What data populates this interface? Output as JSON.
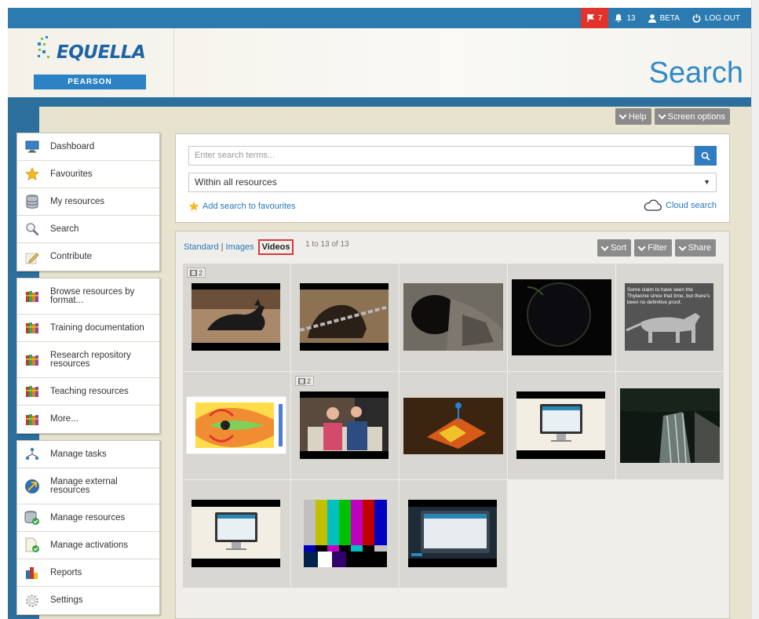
{
  "topbar": {
    "notifications_flag": "7",
    "notifications_bell": "13",
    "user": "BETA",
    "logout": "LOG OUT"
  },
  "header": {
    "logo_text": "EQUELLA",
    "logo_sub": "PEARSON",
    "page_title": "Search"
  },
  "header_buttons": {
    "help": "Help",
    "screen_options": "Screen options"
  },
  "sidebar": {
    "group1": [
      {
        "label": "Dashboard",
        "icon": "monitor-icon"
      },
      {
        "label": "Favourites",
        "icon": "star-icon"
      },
      {
        "label": "My resources",
        "icon": "stack-icon"
      },
      {
        "label": "Search",
        "icon": "magnifier-icon"
      },
      {
        "label": "Contribute",
        "icon": "pencil-icon"
      }
    ],
    "group2": [
      {
        "label": "Browse resources by format...",
        "icon": "books-icon"
      },
      {
        "label": "Training documentation",
        "icon": "books-icon"
      },
      {
        "label": "Research repository resources",
        "icon": "books-icon"
      },
      {
        "label": "Teaching resources",
        "icon": "books-icon"
      },
      {
        "label": "More...",
        "icon": "books-icon"
      }
    ],
    "group3": [
      {
        "label": "Manage tasks",
        "icon": "workflow-icon"
      },
      {
        "label": "Manage external resources",
        "icon": "external-icon"
      },
      {
        "label": "Manage resources",
        "icon": "database-check-icon"
      },
      {
        "label": "Manage activations",
        "icon": "document-check-icon"
      },
      {
        "label": "Reports",
        "icon": "bar-chart-icon"
      },
      {
        "label": "Settings",
        "icon": "gear-icon"
      }
    ]
  },
  "search": {
    "placeholder": "Enter search terms...",
    "within": "Within all resources",
    "add_favourite": "Add search to favourites",
    "cloud_search": "Cloud search"
  },
  "results": {
    "view_standard": "Standard",
    "view_images": "Images",
    "view_videos": "Videos",
    "count": "1 to 13 of 13",
    "sort": "Sort",
    "filter": "Filter",
    "share": "Share",
    "badge_count": "2",
    "tiger_caption": "Some claim to have seen the Thylacine since that time, but there's been no definitive proof."
  }
}
